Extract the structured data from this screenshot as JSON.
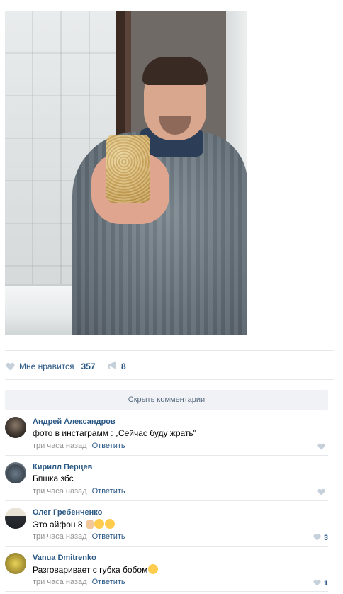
{
  "post": {
    "photo_icon": "selfie-photo"
  },
  "actions": {
    "like_label": "Мне нравится",
    "like_count": "357",
    "share_count": "8",
    "like_icon": "heart-icon",
    "share_icon": "megaphone-icon"
  },
  "comments_toggle": "Скрыть комментарии",
  "comments": [
    {
      "author": "Андрей Александров",
      "text": "фото в инстаграмм : „Сейчас буду жрать\"",
      "emoji": [],
      "time": "три часа назад",
      "reply": "Ответить",
      "likes": ""
    },
    {
      "author": "Кирилл Перцев",
      "text": "Бпшка збс",
      "emoji": [],
      "time": "три часа назад",
      "reply": "Ответить",
      "likes": ""
    },
    {
      "author": "Олег Гребенченко",
      "text": "Это айфон 8",
      "emoji": [
        "pointing-up",
        "smiling-face",
        "laughing-face"
      ],
      "time": "три часа назад",
      "reply": "Ответить",
      "likes": "3"
    },
    {
      "author": "Vanua Dmitrenko",
      "text": "Разговаривает с губка бобом",
      "emoji": [
        "laughing-face"
      ],
      "time": "три часа назад",
      "reply": "Ответить",
      "likes": "1"
    }
  ],
  "colors": {
    "link": "#2a5885",
    "meta": "#939393",
    "divider": "#e7e8ec",
    "button_bg": "#f0f2f5"
  }
}
